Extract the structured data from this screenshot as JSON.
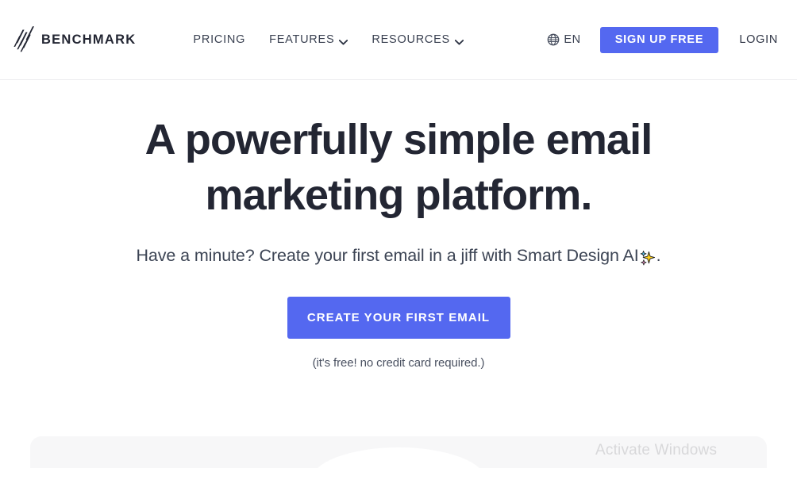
{
  "header": {
    "logo": {
      "icon": "benchmark-slash-logo",
      "name": "BENCHMARK"
    },
    "nav": [
      {
        "label": "PRICING",
        "has_caret": false
      },
      {
        "label": "FEATURES",
        "has_caret": true
      },
      {
        "label": "RESOURCES",
        "has_caret": true
      }
    ],
    "language": {
      "icon": "globe-icon",
      "label": "EN"
    },
    "signup_label": "SIGN UP FREE",
    "login_label": "LOGIN",
    "accent_color": "#5468f0"
  },
  "hero": {
    "title_line_1": "A powerfully simple email",
    "title_line_2": "marketing platform.",
    "subtitle_before": "Have a minute? Create your first email in a jiff with Smart Design AI",
    "subtitle_emoji": "sparkles-icon",
    "subtitle_after": ".",
    "cta_label": "CREATE YOUR FIRST EMAIL",
    "note": "(it's free! no credit card required.)",
    "title_color": "#232633",
    "cta_color": "#5468f0"
  },
  "watermark": {
    "line_1": "Activate Windows"
  }
}
